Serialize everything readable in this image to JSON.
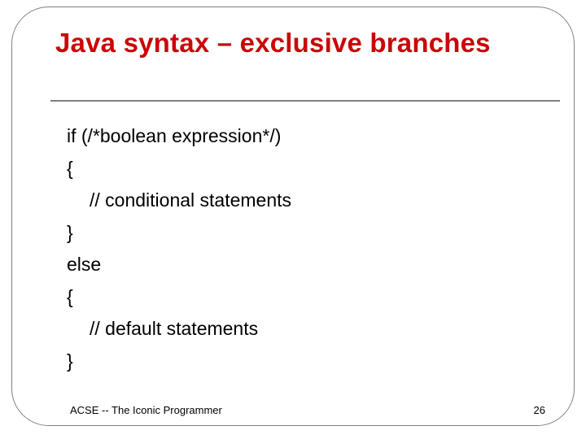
{
  "slide": {
    "title": "Java syntax – exclusive branches",
    "code": {
      "l1": "if (/*boolean expression*/)",
      "l2": "{",
      "l3": "// conditional statements",
      "l4": "}",
      "l5": "else",
      "l6": "{",
      "l7": "// default statements",
      "l8": "}"
    },
    "footer_left": "ACSE -- The Iconic Programmer",
    "page_number": "26"
  }
}
